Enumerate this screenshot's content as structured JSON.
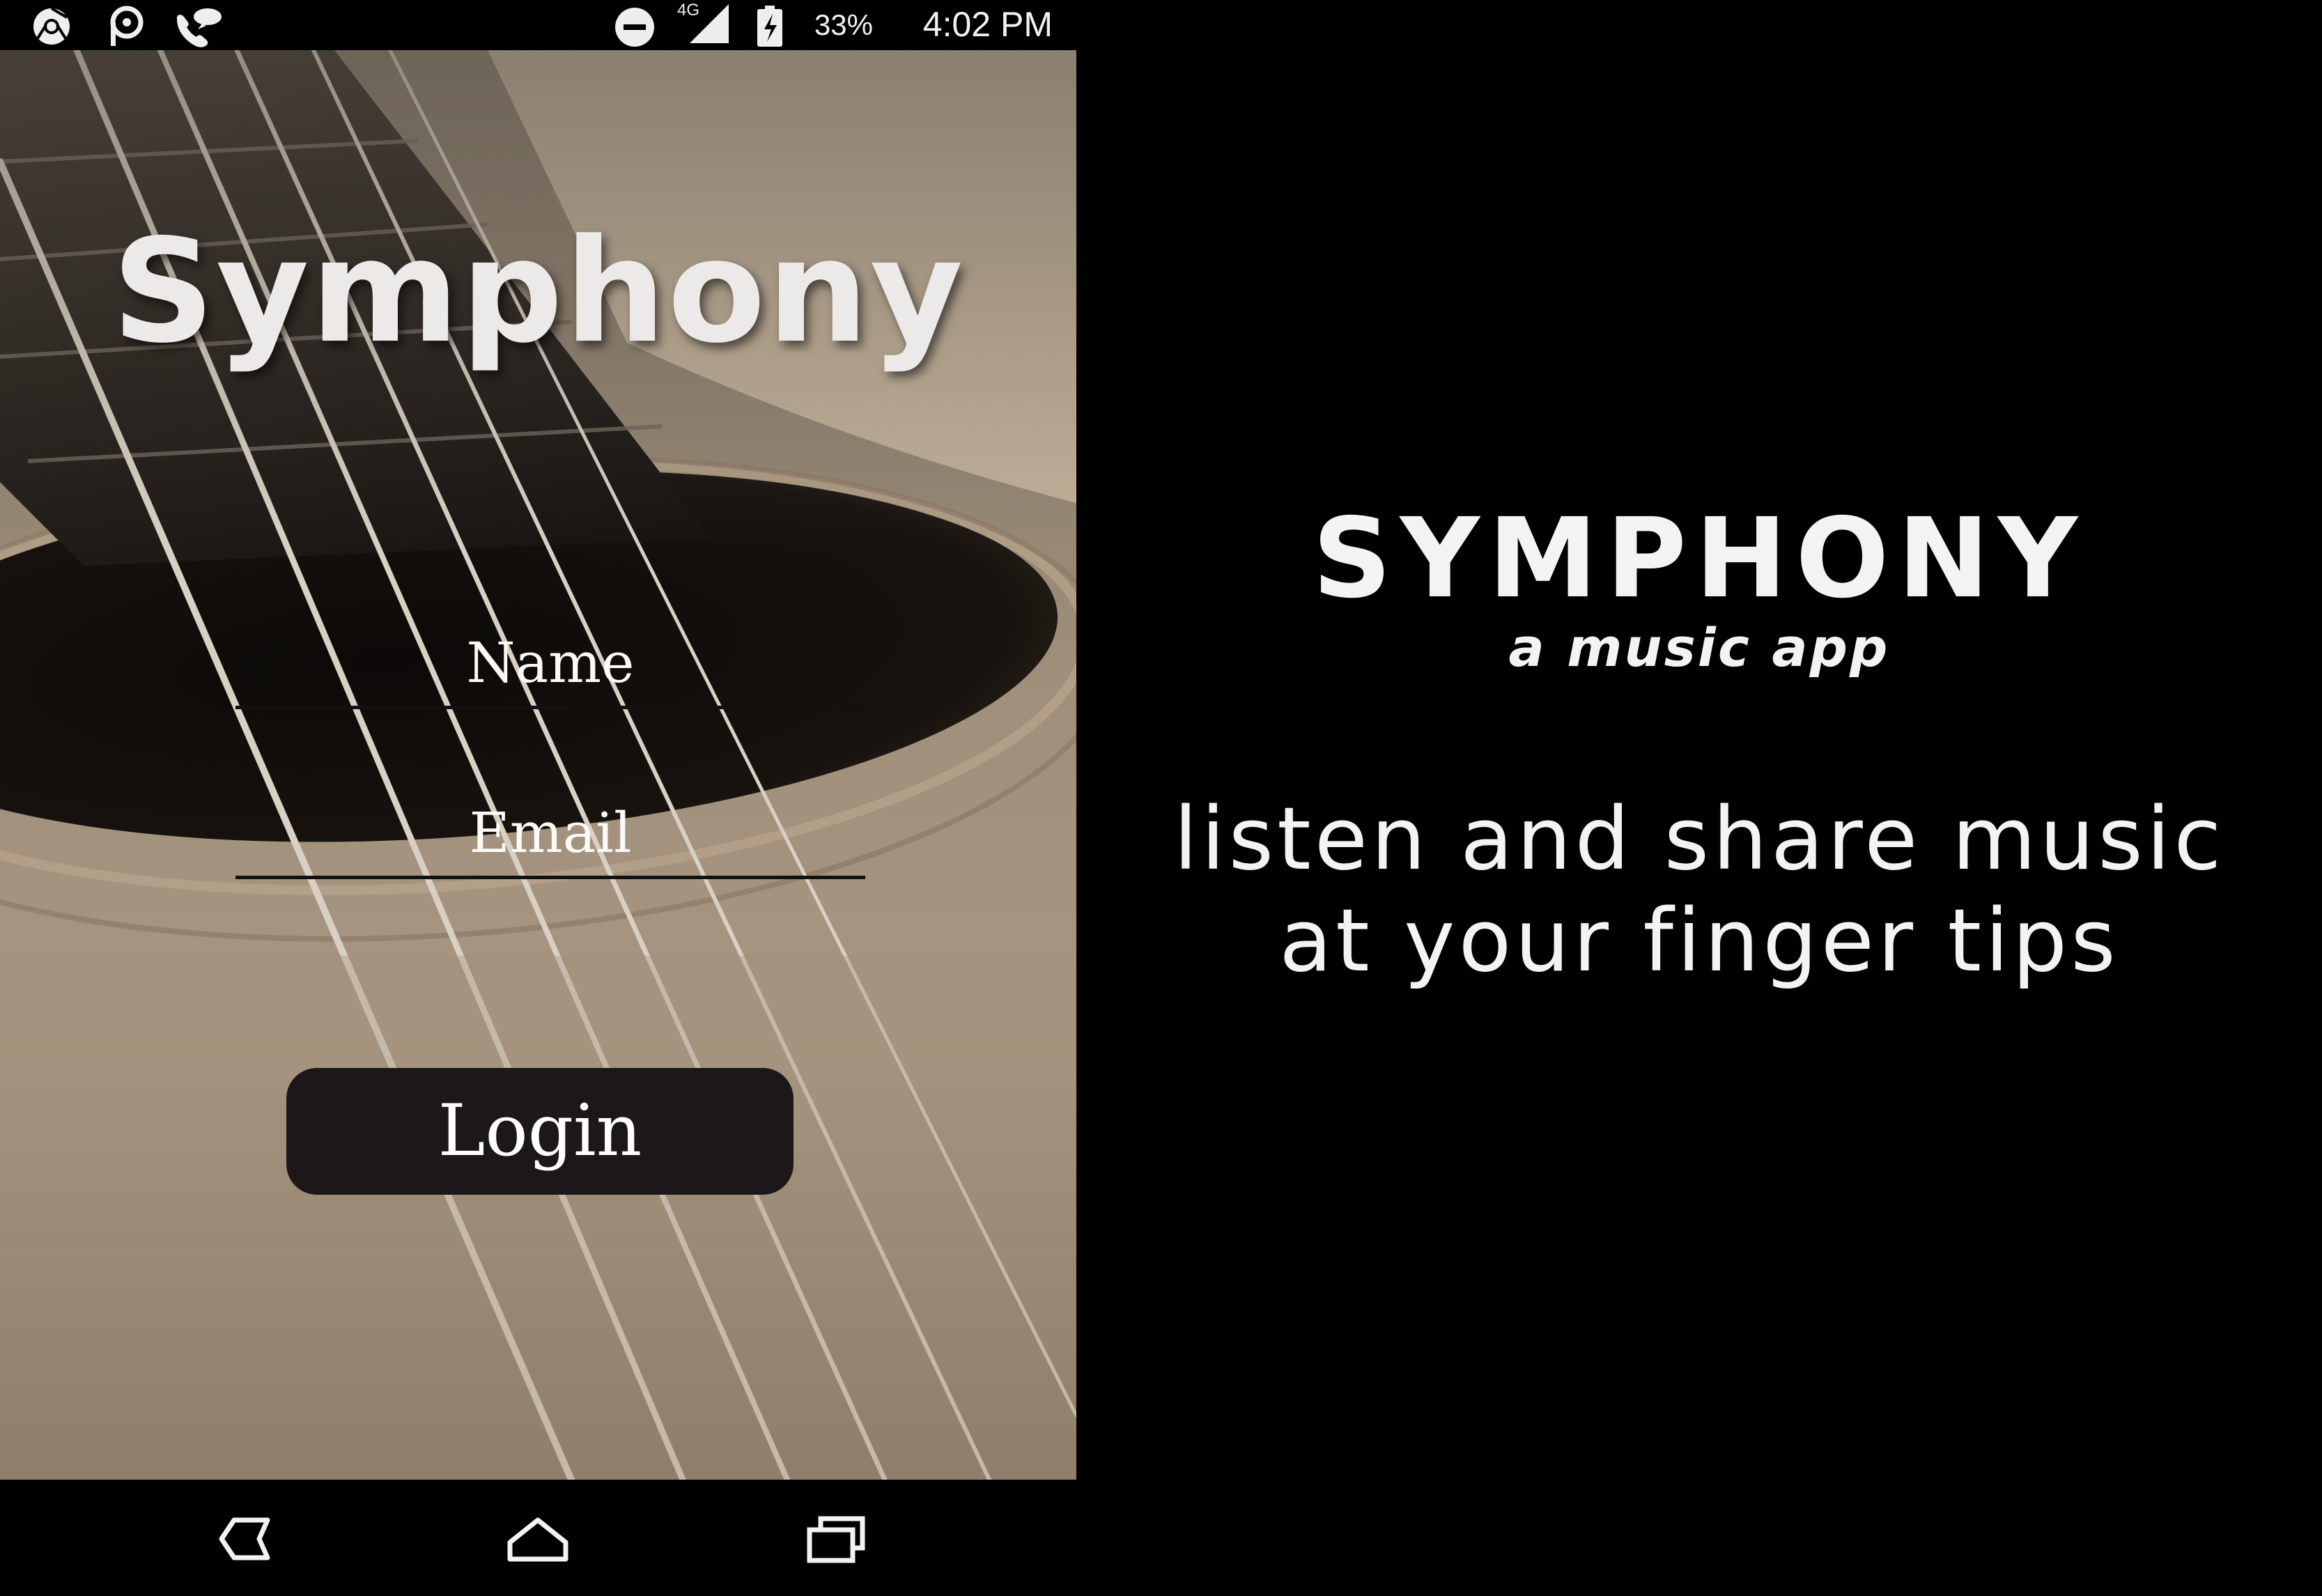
{
  "status_bar": {
    "network_type": "4G",
    "battery_percent": "33%",
    "time": "4:02 PM",
    "left_icons": [
      "chrome-icon",
      "picsart-icon",
      "call-chat-icon"
    ],
    "right_icons": [
      "do-not-disturb-icon",
      "signal-icon",
      "battery-icon"
    ]
  },
  "login_screen": {
    "title": "Symphony",
    "name_placeholder": "Name",
    "email_placeholder": "Email",
    "login_label": "Login",
    "background": "acoustic guitar strings and sound hole photo"
  },
  "nav_bar": {
    "buttons": [
      "back-icon",
      "home-icon",
      "recents-icon"
    ]
  },
  "promo": {
    "title": "SYMPHONY",
    "subtitle": "a music app",
    "tagline_line1": "listen and share music",
    "tagline_line2": "at your finger tips"
  },
  "colors": {
    "background": "#000000",
    "text_light": "#f3f3f3",
    "button_bg": "#1c1718",
    "field_underline": "#111111"
  }
}
